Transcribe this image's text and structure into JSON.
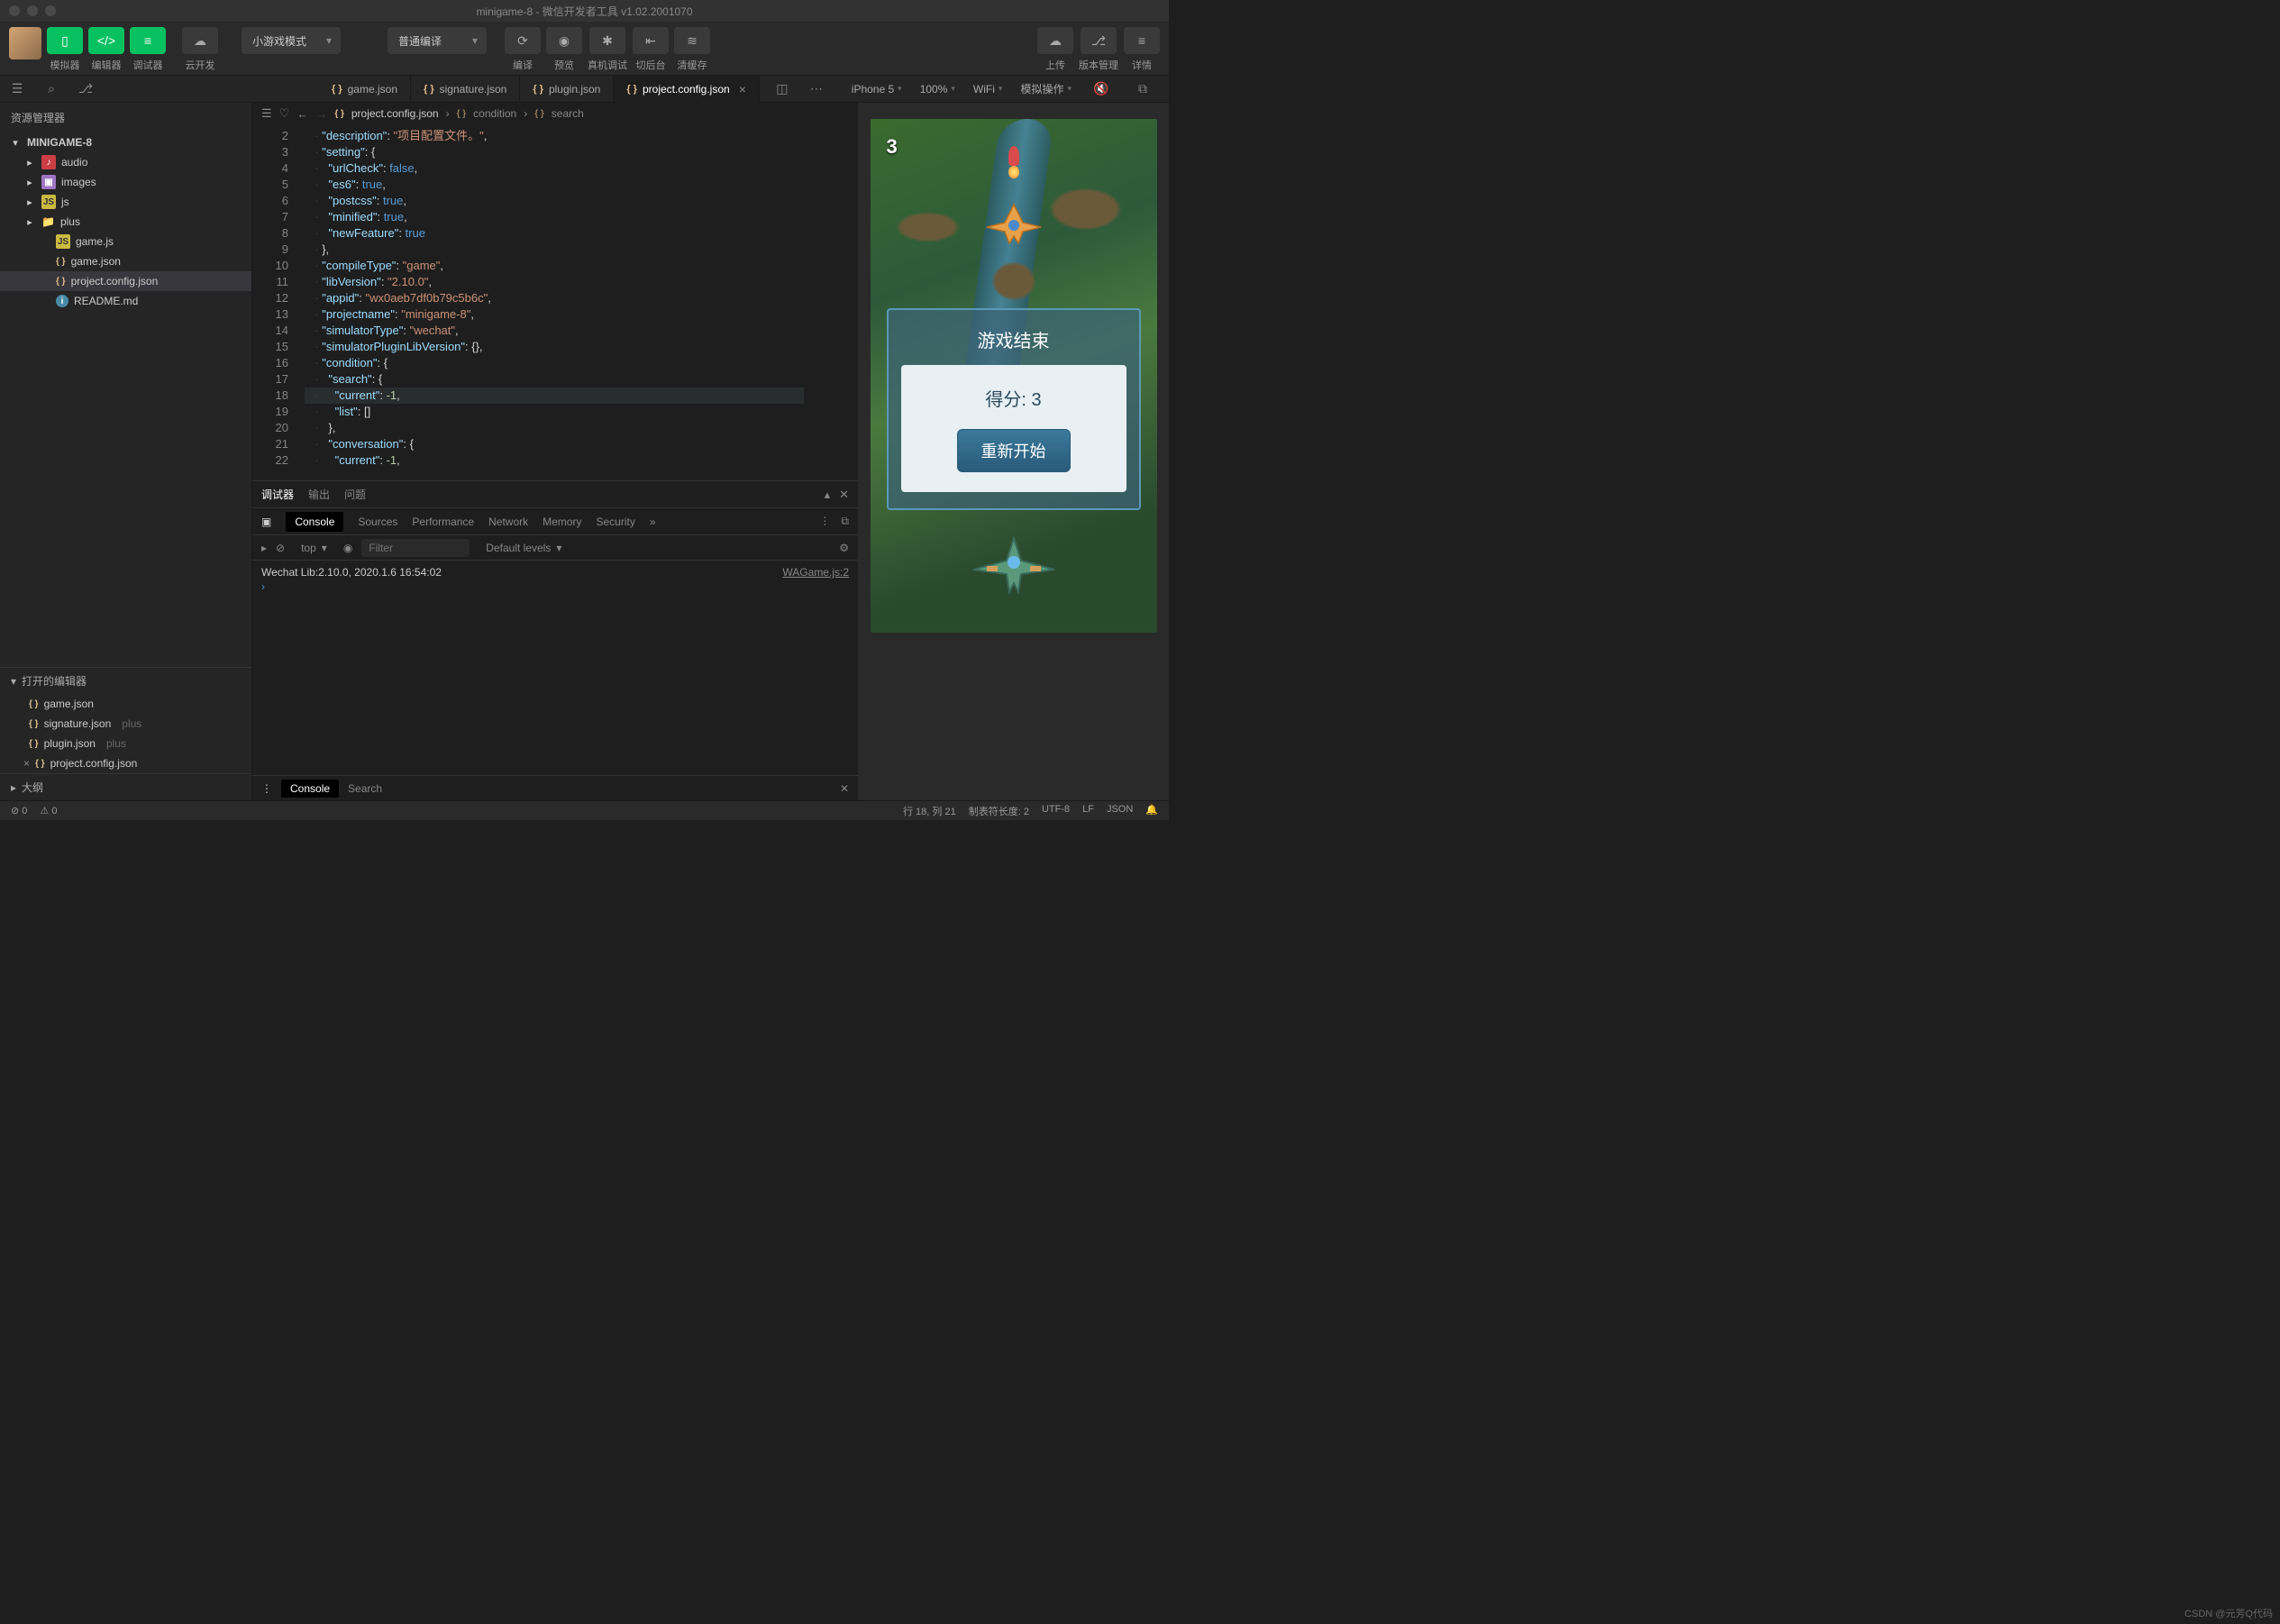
{
  "title": "minigame-8 - 微信开发者工具 v1.02.2001070",
  "toolbar": {
    "simulator": "模拟器",
    "editor": "编辑器",
    "debugger": "调试器",
    "cloud": "云开发",
    "mode": "小游戏模式",
    "compile": "普通编译",
    "compile_btn": "编译",
    "preview": "预览",
    "remote": "真机调试",
    "background": "切后台",
    "clear": "清缓存",
    "upload": "上传",
    "version": "版本管理",
    "detail": "详情"
  },
  "subbar": {
    "device": "iPhone 5",
    "zoom": "100%",
    "wifi": "WiFi",
    "sim": "模拟操作"
  },
  "sidebar": {
    "title": "资源管理器",
    "root": "MINIGAME-8",
    "items": [
      {
        "icon": "red",
        "glyph": "♪",
        "label": "audio",
        "indent": 1,
        "chev": "▸"
      },
      {
        "icon": "purple",
        "glyph": "▣",
        "label": "images",
        "indent": 1,
        "chev": "▸"
      },
      {
        "icon": "yellow",
        "glyph": "JS",
        "label": "js",
        "indent": 1,
        "chev": "▸"
      },
      {
        "icon": "folder",
        "glyph": "📁",
        "label": "plus",
        "indent": 1,
        "chev": "▸"
      },
      {
        "icon": "yellow",
        "glyph": "JS",
        "label": "game.js",
        "indent": 2
      },
      {
        "icon": "json",
        "glyph": "{ }",
        "label": "game.json",
        "indent": 2
      },
      {
        "icon": "json",
        "glyph": "{ }",
        "label": "project.config.json",
        "indent": 2,
        "sel": true
      },
      {
        "icon": "info",
        "glyph": "i",
        "label": "README.md",
        "indent": 2
      }
    ],
    "open_editors": "打开的编辑器",
    "open": [
      {
        "label": "game.json"
      },
      {
        "label": "signature.json",
        "suffix": "plus"
      },
      {
        "label": "plugin.json",
        "suffix": "plus"
      },
      {
        "label": "project.config.json",
        "close": true
      }
    ],
    "outline": "大纲"
  },
  "tabs": [
    {
      "label": "game.json"
    },
    {
      "label": "signature.json"
    },
    {
      "label": "plugin.json"
    },
    {
      "label": "project.config.json",
      "active": true,
      "close": true
    }
  ],
  "breadcrumb": {
    "file": "project.config.json",
    "p1": "condition",
    "p2": "search"
  },
  "code": {
    "start": 2,
    "hl": 18,
    "lines": [
      [
        [
          "k",
          "\"description\""
        ],
        [
          "p",
          ": "
        ],
        [
          "s",
          "\"项目配置文件。\""
        ],
        [
          "p",
          ","
        ]
      ],
      [
        [
          "k",
          "\"setting\""
        ],
        [
          "p",
          ": {"
        ]
      ],
      [
        [
          "k",
          "  \"urlCheck\""
        ],
        [
          "p",
          ": "
        ],
        [
          "b",
          "false"
        ],
        [
          "p",
          ","
        ]
      ],
      [
        [
          "k",
          "  \"es6\""
        ],
        [
          "p",
          ": "
        ],
        [
          "b",
          "true"
        ],
        [
          "p",
          ","
        ]
      ],
      [
        [
          "k",
          "  \"postcss\""
        ],
        [
          "p",
          ": "
        ],
        [
          "b",
          "true"
        ],
        [
          "p",
          ","
        ]
      ],
      [
        [
          "k",
          "  \"minified\""
        ],
        [
          "p",
          ": "
        ],
        [
          "b",
          "true"
        ],
        [
          "p",
          ","
        ]
      ],
      [
        [
          "k",
          "  \"newFeature\""
        ],
        [
          "p",
          ": "
        ],
        [
          "b",
          "true"
        ]
      ],
      [
        [
          "p",
          "},"
        ]
      ],
      [
        [
          "k",
          "\"compileType\""
        ],
        [
          "p",
          ": "
        ],
        [
          "s",
          "\"game\""
        ],
        [
          "p",
          ","
        ]
      ],
      [
        [
          "k",
          "\"libVersion\""
        ],
        [
          "p",
          ": "
        ],
        [
          "s",
          "\"2.10.0\""
        ],
        [
          "p",
          ","
        ]
      ],
      [
        [
          "k",
          "\"appid\""
        ],
        [
          "p",
          ": "
        ],
        [
          "s",
          "\"wx0aeb7df0b79c5b6c\""
        ],
        [
          "p",
          ","
        ]
      ],
      [
        [
          "k",
          "\"projectname\""
        ],
        [
          "p",
          ": "
        ],
        [
          "s",
          "\"minigame-8\""
        ],
        [
          "p",
          ","
        ]
      ],
      [
        [
          "k",
          "\"simulatorType\""
        ],
        [
          "p",
          ": "
        ],
        [
          "s",
          "\"wechat\""
        ],
        [
          "p",
          ","
        ]
      ],
      [
        [
          "k",
          "\"simulatorPluginLibVersion\""
        ],
        [
          "p",
          ": {},"
        ]
      ],
      [
        [
          "k",
          "\"condition\""
        ],
        [
          "p",
          ": {"
        ]
      ],
      [
        [
          "k",
          "  \"search\""
        ],
        [
          "p",
          ": {"
        ]
      ],
      [
        [
          "k",
          "    \"current\""
        ],
        [
          "p",
          ": "
        ],
        [
          "n",
          "-1"
        ],
        [
          "p",
          ","
        ]
      ],
      [
        [
          "k",
          "    \"list\""
        ],
        [
          "p",
          ": []"
        ]
      ],
      [
        [
          "p",
          "  },"
        ]
      ],
      [
        [
          "k",
          "  \"conversation\""
        ],
        [
          "p",
          ": {"
        ]
      ],
      [
        [
          "k",
          "    \"current\""
        ],
        [
          "p",
          ": "
        ],
        [
          "n",
          "-1"
        ],
        [
          "p",
          ","
        ]
      ]
    ]
  },
  "panel": {
    "tabs": [
      "调试器",
      "输出",
      "问题"
    ],
    "dev_tabs": [
      "Console",
      "Sources",
      "Performance",
      "Network",
      "Memory",
      "Security"
    ],
    "context": "top",
    "filter_ph": "Filter",
    "levels": "Default levels",
    "log": "Wechat Lib:2.10.0, 2020.1.6 16:54:02",
    "log_src": "WAGame.js:2",
    "bottom_btn": "Console",
    "search": "Search"
  },
  "status": {
    "errors": "0",
    "warnings": "0",
    "cursor": "行 18, 列 21",
    "tab": "制表符长度: 2",
    "enc": "UTF-8",
    "eol": "LF",
    "lang": "JSON"
  },
  "simulator": {
    "score": "3",
    "dialog_title": "游戏结束",
    "dialog_score": "得分: 3",
    "restart": "重新开始"
  },
  "watermark": "CSDN @元芳Q代码"
}
